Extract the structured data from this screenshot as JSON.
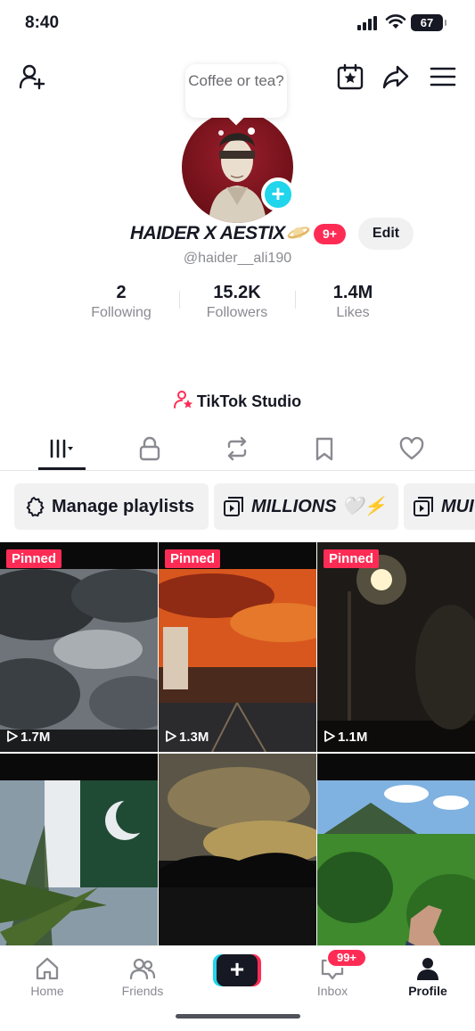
{
  "status_bar": {
    "time": "8:40",
    "battery": "67"
  },
  "profile": {
    "bubble_text": "Coffee or tea?",
    "display_name": "HAIDER X AESTIX",
    "notification_count": "9+",
    "edit_label": "Edit",
    "handle": "@haider__ali190"
  },
  "stats": [
    {
      "value": "2",
      "label": "Following"
    },
    {
      "value": "15.2K",
      "label": "Followers"
    },
    {
      "value": "1.4M",
      "label": "Likes"
    }
  ],
  "studio_label": "TikTok Studio",
  "tabs": [
    "videos-icon",
    "lock-icon",
    "repost-icon",
    "bookmark-icon",
    "heart-icon"
  ],
  "playlists": [
    {
      "label": "Manage playlists"
    },
    {
      "label": "MILLIONS 🤍⚡"
    },
    {
      "label": "MUI"
    }
  ],
  "videos": [
    {
      "pinned": "Pinned",
      "views": "1.7M"
    },
    {
      "pinned": "Pinned",
      "views": "1.3M"
    },
    {
      "pinned": "Pinned",
      "views": "1.1M"
    },
    {
      "pinned": "",
      "views": ""
    },
    {
      "pinned": "",
      "views": ""
    },
    {
      "pinned": "",
      "views": ""
    }
  ],
  "nav": {
    "home": "Home",
    "friends": "Friends",
    "inbox": "Inbox",
    "inbox_badge": "99+",
    "profile": "Profile"
  },
  "colors": {
    "accent": "#fe2c55",
    "cyan": "#20d5ec",
    "text": "#161823",
    "muted": "#8a8b91"
  }
}
